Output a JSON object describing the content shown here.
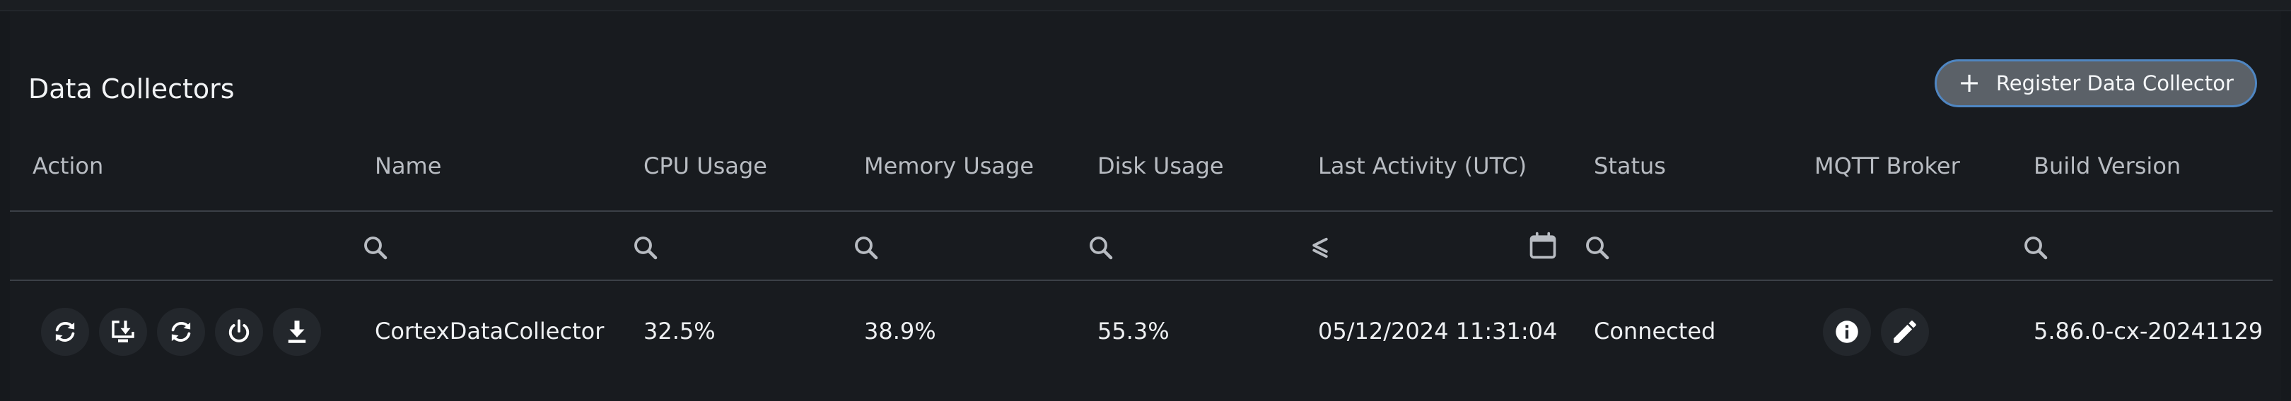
{
  "panel": {
    "title": "Data Collectors",
    "register_label": "Register Data Collector"
  },
  "table": {
    "headers": {
      "action": "Action",
      "name": "Name",
      "cpu": "CPU Usage",
      "memory": "Memory Usage",
      "disk": "Disk Usage",
      "last_activity": "Last Activity (UTC)",
      "status": "Status",
      "mqtt": "MQTT Broker",
      "build": "Build Version"
    },
    "filters": {
      "name": "search-icon",
      "cpu": "search-icon",
      "memory": "search-icon",
      "disk": "search-icon",
      "last_activity_operator": "less-than-or-equal-icon",
      "last_activity_picker": "calendar-icon",
      "status": "search-icon",
      "build": "search-icon"
    },
    "rows": [
      {
        "actions": [
          "sync-icon",
          "install-icon",
          "refresh-icon",
          "power-icon",
          "download-icon"
        ],
        "name": "CortexDataCollector",
        "cpu": "32.5%",
        "memory": "38.9%",
        "disk": "55.3%",
        "last_activity": "05/12/2024 11:31:04",
        "status": "Connected",
        "mqtt_actions": [
          "info-icon",
          "edit-icon"
        ],
        "build": "5.86.0-cx-20241129"
      }
    ]
  },
  "colors": {
    "background": "#16191d",
    "panel": "#181b1f",
    "button_fill": "#5b6168",
    "button_border": "#4f86c2",
    "divider": "#3b4047"
  }
}
